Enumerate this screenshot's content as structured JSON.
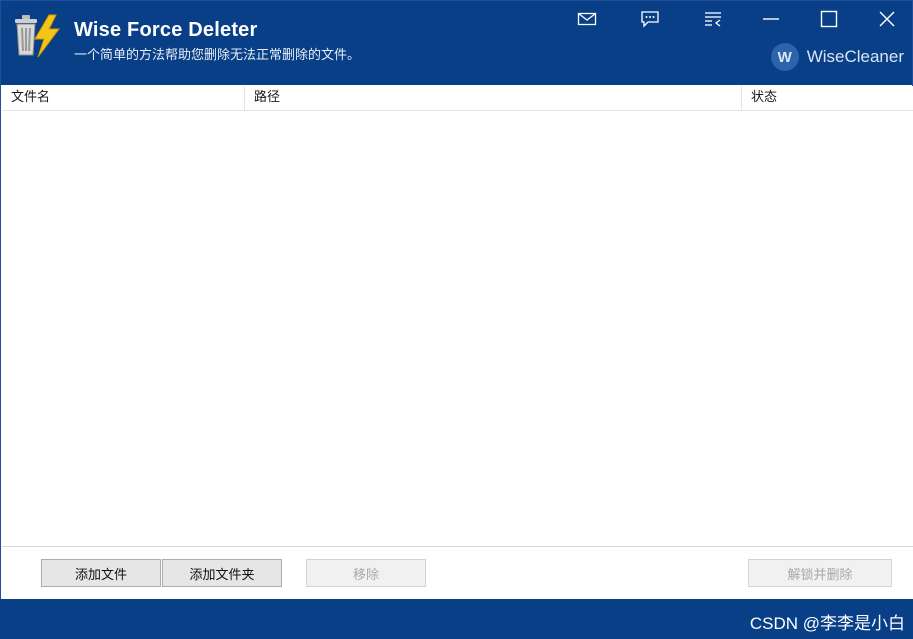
{
  "app": {
    "title": "Wise Force Deleter",
    "subtitle": "一个简单的方法帮助您删除无法正常删除的文件。",
    "brand": "WiseCleaner",
    "brand_badge": "W"
  },
  "titlebar_buttons": [
    "mail-icon",
    "feedback-icon",
    "menu-icon",
    "minimize-icon",
    "maximize-icon",
    "close-icon"
  ],
  "table": {
    "columns": [
      "文件名",
      "路径",
      "状态"
    ],
    "rows": []
  },
  "actions": {
    "add_file": "添加文件",
    "add_folder": "添加文件夹",
    "remove": "移除",
    "unlock_delete": "解锁并删除"
  },
  "footer": {
    "watermark": "CSDN @李李是小白"
  },
  "colors": {
    "brand_blue": "#083f87",
    "button_bg": "#e6e6e6",
    "disabled_text": "#a8a8a8"
  }
}
